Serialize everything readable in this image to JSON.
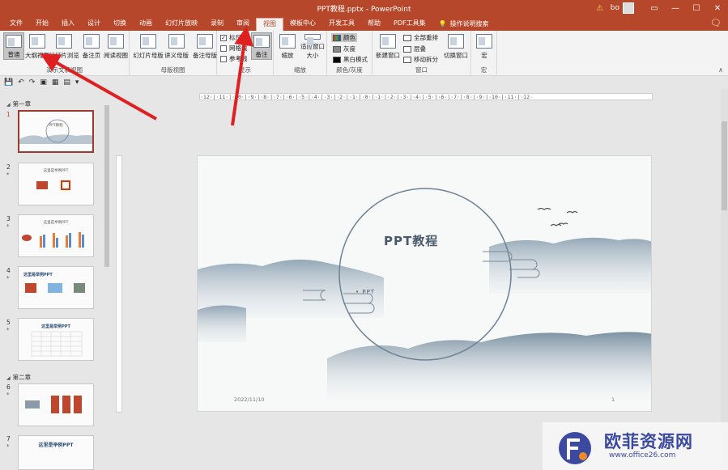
{
  "window": {
    "title": "PPT教程.pptx  -  PowerPoint",
    "user": "bo"
  },
  "tabs": [
    "文件",
    "开始",
    "插入",
    "设计",
    "切换",
    "动画",
    "幻灯片放映",
    "录制",
    "审阅",
    "视图",
    "模板中心",
    "开发工具",
    "帮助",
    "PDF工具集",
    "操作说明搜索"
  ],
  "active_tab": "视图",
  "ribbon": {
    "views": [
      "普通",
      "大纲视图",
      "幻灯片浏览",
      "备注页",
      "阅读视图"
    ],
    "masters": [
      "幻灯片母版",
      "讲义母版",
      "备注母版"
    ],
    "masters_label": "母版视图",
    "views_label": "演示文稿视图",
    "show": {
      "ruler": "标尺",
      "gridlines": "网格线",
      "guides": "参考线",
      "notes": "备注",
      "label": "显示"
    },
    "zoom": {
      "zoom": "缩放",
      "fit": "适应窗口大小",
      "label": "缩放"
    },
    "color": {
      "color": "颜色",
      "gray": "灰度",
      "bw": "黑白模式",
      "label": "颜色/灰度"
    },
    "window": {
      "new": "新建窗口",
      "arrange": "全部重排",
      "cascade": "层叠",
      "split": "移动拆分",
      "switch": "切换窗口",
      "label": "窗口"
    },
    "macro": {
      "macro": "宏",
      "label": "宏"
    }
  },
  "sections": [
    "第一章",
    "第二章"
  ],
  "slides": [
    {
      "num": "1",
      "title": "PPT教程"
    },
    {
      "num": "2",
      "title": "这里是举例PPT"
    },
    {
      "num": "3",
      "title": "这里是举例PPT"
    },
    {
      "num": "4",
      "title": "这里是举例PPT"
    },
    {
      "num": "5",
      "title": "这里是举例PPT"
    },
    {
      "num": "6",
      "title": ""
    },
    {
      "num": "7",
      "title": "这里是举例PPT"
    }
  ],
  "ruler_text": "·12·|·11·|·10·|·9·|·8·|·7·|·6·|·5·|·4·|·3·|·2·|·1·|·0·|·1·|·2·|·3·|·4·|·5·|·6·|·7·|·8·|·9·|·10·|·11·|·12·",
  "slide": {
    "title": "PPT教程",
    "subtitle": "• PPT",
    "date": "2022/11/10",
    "page": "1"
  },
  "watermark": {
    "text": "欧菲资源网",
    "url": "www.office26.com"
  },
  "colors": {
    "accent": "#b7472a",
    "arrow": "#e02020"
  }
}
